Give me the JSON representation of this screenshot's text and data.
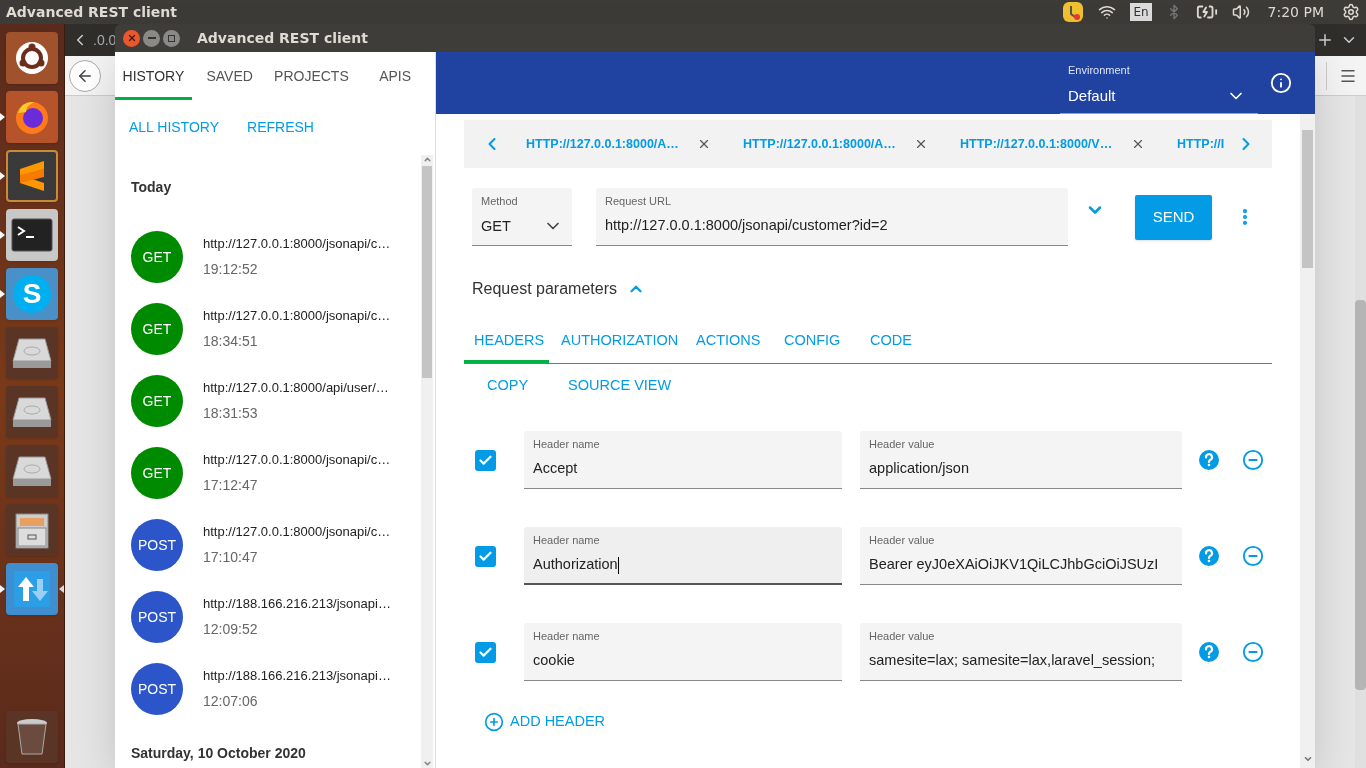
{
  "top_bar": {
    "title": "Advanced REST client",
    "keyboard": "En",
    "clock": "7:20 PM"
  },
  "launcher": [
    {
      "kind": "dash",
      "running": false,
      "focused": false
    },
    {
      "kind": "firefox",
      "running": true,
      "focused": false
    },
    {
      "kind": "sublime",
      "running": true,
      "focused": false
    },
    {
      "kind": "terminal",
      "running": true,
      "focused": false
    },
    {
      "kind": "skype",
      "running": true,
      "focused": false,
      "glyph": "S"
    },
    {
      "kind": "drive",
      "running": false,
      "focused": false
    },
    {
      "kind": "drive",
      "running": false,
      "focused": false
    },
    {
      "kind": "drive",
      "running": false,
      "focused": false
    },
    {
      "kind": "files",
      "running": false,
      "focused": false
    },
    {
      "kind": "transfer",
      "running": true,
      "focused": true
    },
    {
      "kind": "trash",
      "running": false,
      "focused": false
    }
  ],
  "browser": {
    "address_fragment": ".0.0"
  },
  "window": {
    "title": "Advanced REST client"
  },
  "sidebar": {
    "tabs": [
      {
        "label": "HISTORY",
        "selected": true
      },
      {
        "label": "SAVED",
        "selected": false
      },
      {
        "label": "PROJECTS",
        "selected": false
      },
      {
        "label": "APIS",
        "selected": false
      }
    ],
    "actions": [
      "ALL HISTORY",
      "REFRESH"
    ],
    "groups": [
      {
        "title": "Today",
        "items": [
          {
            "method": "GET",
            "color": "#008a00",
            "url": "http://127.0.0.1:8000/jsonapi/c…",
            "time": "19:12:52"
          },
          {
            "method": "GET",
            "color": "#008a00",
            "url": "http://127.0.0.1:8000/jsonapi/c…",
            "time": "18:34:51"
          },
          {
            "method": "GET",
            "color": "#008a00",
            "url": "http://127.0.0.1:8000/api/user/…",
            "time": "18:31:53"
          },
          {
            "method": "GET",
            "color": "#008a00",
            "url": "http://127.0.0.1:8000/jsonapi/c…",
            "time": "17:12:47"
          },
          {
            "method": "POST",
            "color": "#2b55c8",
            "url": "http://127.0.0.1:8000/jsonapi/c…",
            "time": "17:10:47"
          },
          {
            "method": "POST",
            "color": "#2b55c8",
            "url": "http://188.166.216.213/jsonapi…",
            "time": "12:09:52"
          },
          {
            "method": "POST",
            "color": "#2b55c8",
            "url": "http://188.166.216.213/jsonapi…",
            "time": "12:07:06"
          }
        ]
      },
      {
        "title": "Saturday, 10 October 2020"
      }
    ]
  },
  "header": {
    "environment": {
      "label": "Environment",
      "value": "Default"
    }
  },
  "request_tabs": [
    "HTTP://127.0.0.1:8000/A…",
    "HTTP://127.0.0.1:8000/A…",
    "HTTP://127.0.0.1:8000/V…",
    "HTTP://I"
  ],
  "request": {
    "method": {
      "label": "Method",
      "value": "GET"
    },
    "url": {
      "label": "Request URL",
      "value": "http://127.0.0.1:8000/jsonapi/customer?id=2"
    },
    "send": "SEND"
  },
  "parameters": {
    "title": "Request parameters",
    "expanded": true,
    "tabs": [
      {
        "label": "HEADERS",
        "selected": true
      },
      {
        "label": "AUTHORIZATION",
        "selected": false
      },
      {
        "label": "ACTIONS",
        "selected": false
      },
      {
        "label": "CONFIG",
        "selected": false
      },
      {
        "label": "CODE",
        "selected": false
      }
    ],
    "actions": [
      "COPY",
      "SOURCE VIEW"
    ],
    "headers": [
      {
        "enabled": true,
        "name_label": "Header name",
        "name": "Accept",
        "value_label": "Header value",
        "value": "application/json",
        "focused": false
      },
      {
        "enabled": true,
        "name_label": "Header name",
        "name": "Authorization",
        "value_label": "Header value",
        "value": "Bearer eyJ0eXAiOiJKV1QiLCJhbGciOiJSUzI",
        "focused": true
      },
      {
        "enabled": true,
        "name_label": "Header name",
        "name": "cookie",
        "value_label": "Header value",
        "value": "samesite=lax; samesite=lax,laravel_session;",
        "focused": false
      }
    ],
    "add_header": "ADD HEADER"
  }
}
